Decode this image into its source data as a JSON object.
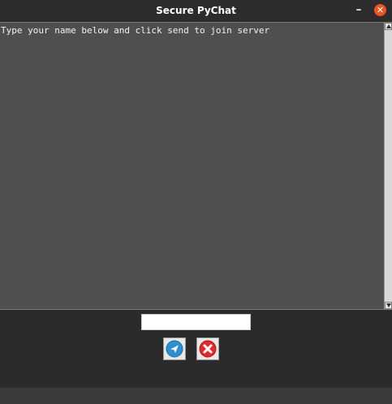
{
  "window": {
    "title": "Secure PyChat",
    "minimize_glyph": "–",
    "close_glyph": "✕"
  },
  "chat": {
    "log_text": "Type your name below and click send to join server"
  },
  "input": {
    "value": "",
    "placeholder": ""
  },
  "buttons": {
    "send_icon": "send-icon",
    "quit_icon": "close-icon"
  },
  "colors": {
    "accent_orange": "#e95420",
    "send_blue": "#2f8fcf",
    "quit_red": "#e32b2b"
  }
}
